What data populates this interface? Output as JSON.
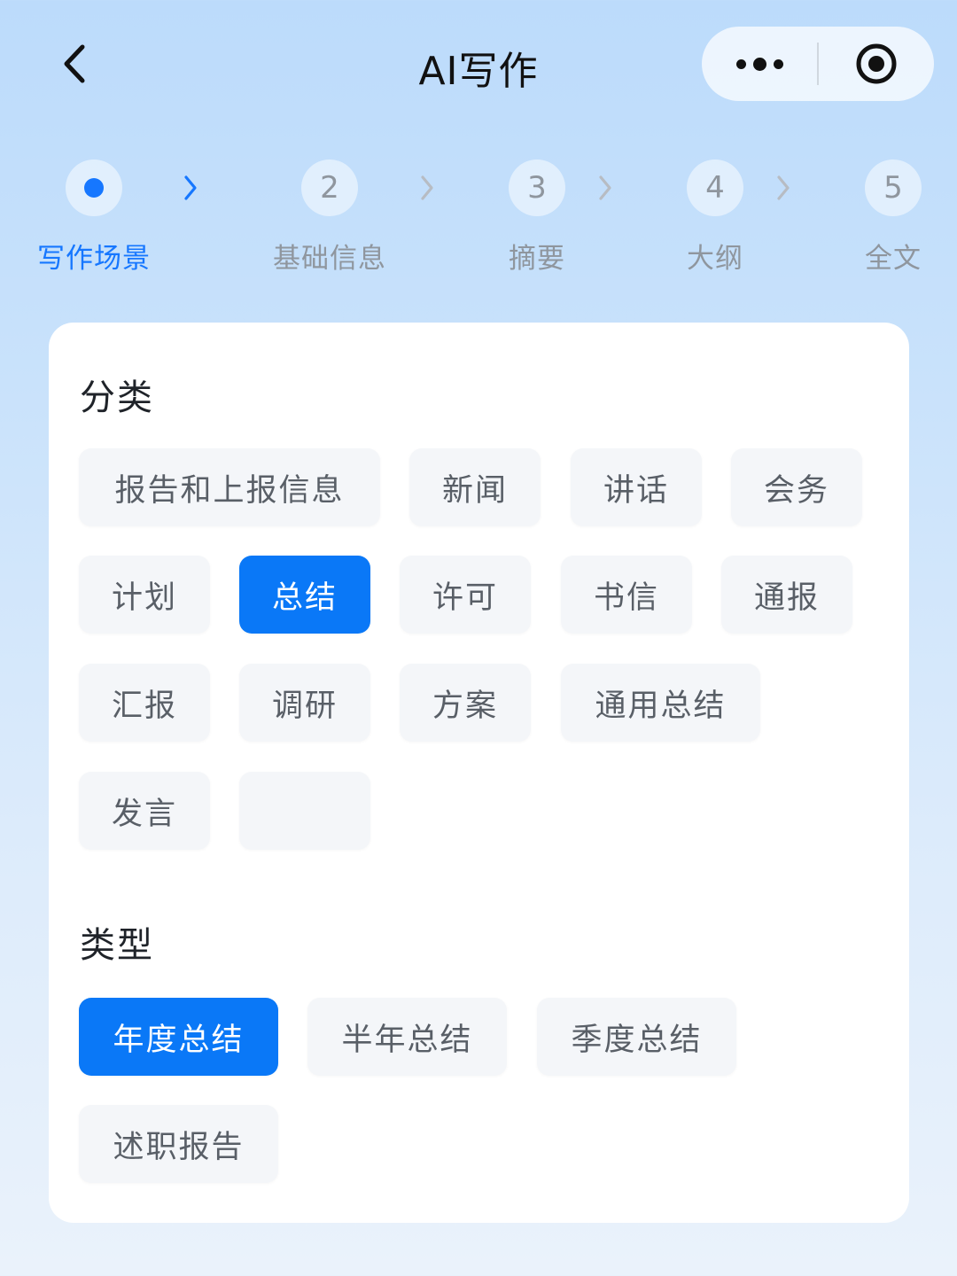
{
  "header": {
    "title": "AI写作",
    "back_icon": "chevron-left-icon",
    "more_icon": "more-dots-icon",
    "close_icon": "target-circle-icon"
  },
  "steps": [
    {
      "number": "",
      "label": "写作场景",
      "active": true
    },
    {
      "number": "2",
      "label": "基础信息",
      "active": false
    },
    {
      "number": "3",
      "label": "摘要",
      "active": false
    },
    {
      "number": "4",
      "label": "大纲",
      "active": false
    },
    {
      "number": "5",
      "label": "全文",
      "active": false
    }
  ],
  "category": {
    "title": "分类",
    "options": [
      "报告和上报信息",
      "新闻",
      "讲话",
      "会务",
      "计划",
      "总结",
      "许可",
      "书信",
      "通报",
      "汇报",
      "调研",
      "方案",
      "通用总结",
      "发言",
      ""
    ],
    "selected": "总结"
  },
  "type": {
    "title": "类型",
    "options": [
      "年度总结",
      "半年总结",
      "季度总结",
      "述职报告"
    ],
    "selected": "年度总结"
  },
  "colors": {
    "accent": "#1677ff",
    "chip_selected": "#0a78f7",
    "chip_bg": "#f4f6f9",
    "inactive_text": "#8f969e"
  }
}
